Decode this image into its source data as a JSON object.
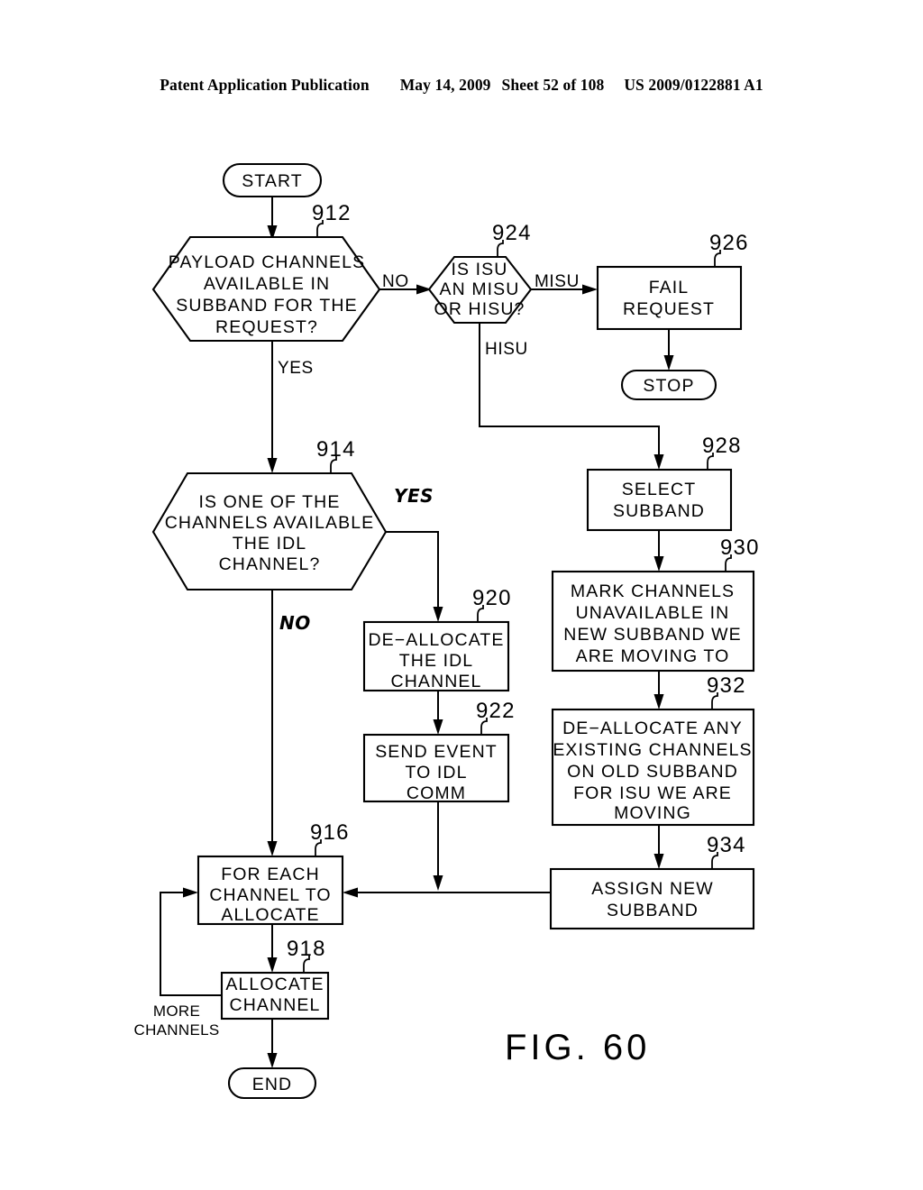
{
  "header": {
    "publication": "Patent Application Publication",
    "date": "May 14, 2009",
    "sheet": "Sheet 52 of 108",
    "patent_number": "US 2009/0122881 A1"
  },
  "figure": {
    "label": "FIG. 60"
  },
  "nodes": {
    "start": {
      "text": "START",
      "shape": "terminator"
    },
    "n912": {
      "ref": "912",
      "shape": "decision",
      "lines": [
        "PAYLOAD  CHANNELS",
        "AVAILABLE  IN",
        "SUBBAND  FOR  THE",
        "REQUEST?"
      ]
    },
    "n924": {
      "ref": "924",
      "shape": "decision",
      "lines": [
        "IS  ISU",
        "AN  MISU",
        "OR  HISU?"
      ]
    },
    "n926": {
      "ref": "926",
      "shape": "process",
      "lines": [
        "FAIL",
        "REQUEST"
      ]
    },
    "stop": {
      "text": "STOP",
      "shape": "terminator"
    },
    "n914": {
      "ref": "914",
      "shape": "decision",
      "lines": [
        "IS  ONE  OF  THE",
        "CHANNELS  AVAILABLE",
        "THE  IDL",
        "CHANNEL?"
      ]
    },
    "n928": {
      "ref": "928",
      "shape": "process",
      "lines": [
        "SELECT",
        "SUBBAND"
      ]
    },
    "n930": {
      "ref": "930",
      "shape": "process",
      "lines": [
        "MARK  CHANNELS",
        "UNAVAILABLE  IN",
        "NEW  SUBBAND  WE",
        "ARE  MOVING  TO"
      ]
    },
    "n932": {
      "ref": "932",
      "shape": "process",
      "lines": [
        "DE−ALLOCATE  ANY",
        "EXISTING  CHANNELS",
        "ON  OLD  SUBBAND",
        "FOR  ISU  WE  ARE",
        "MOVING"
      ]
    },
    "n934": {
      "ref": "934",
      "shape": "process",
      "lines": [
        "ASSIGN  NEW",
        "SUBBAND"
      ]
    },
    "n920": {
      "ref": "920",
      "shape": "process",
      "lines": [
        "DE−ALLOCATE",
        "THE  IDL",
        "CHANNEL"
      ]
    },
    "n922": {
      "ref": "922",
      "shape": "process",
      "lines": [
        "SEND  EVENT",
        "TO  IDL",
        "COMM"
      ]
    },
    "n916": {
      "ref": "916",
      "shape": "process",
      "lines": [
        "FOR  EACH",
        "CHANNEL  TO",
        "ALLOCATE"
      ]
    },
    "n918": {
      "ref": "918",
      "shape": "process",
      "lines": [
        "ALLOCATE",
        "CHANNEL"
      ]
    },
    "end": {
      "text": "END",
      "shape": "terminator"
    }
  },
  "edge_labels": {
    "no_912": "NO",
    "yes_912": "YES",
    "misu_924": "MISU",
    "hisu_924": "HISU",
    "yes_914": "YES",
    "no_914": "NO",
    "more_channels_1": "MORE",
    "more_channels_2": "CHANNELS"
  }
}
